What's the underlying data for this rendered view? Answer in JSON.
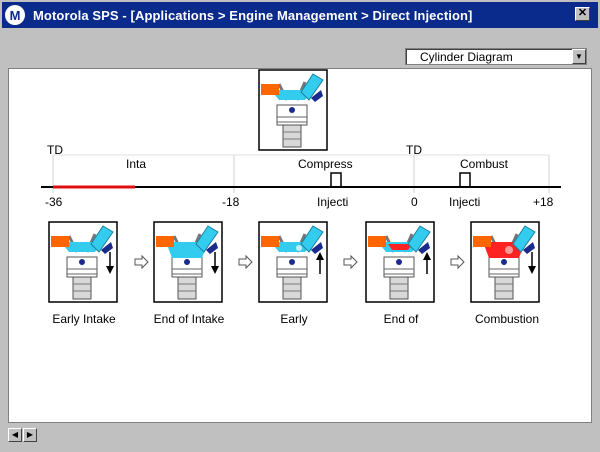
{
  "window": {
    "logo_glyph": "M",
    "title": "Motorola SPS - [Applications > Engine Management > Direct Injection]",
    "close_glyph": "✕"
  },
  "view_select": {
    "value": "Cylinder Diagram",
    "arrow": "▼"
  },
  "timeline": {
    "td_labels": [
      "TD",
      "TD"
    ],
    "phases": [
      "Inta",
      "Compress",
      "Combust"
    ],
    "ticks": [
      "-36",
      "-18",
      "Injecti",
      "0",
      "Injecti",
      "+18"
    ]
  },
  "stages": [
    {
      "caption": "Early Intake",
      "arrow": "down"
    },
    {
      "caption": "End of Intake",
      "arrow": "down"
    },
    {
      "caption": "Early",
      "arrow": "up"
    },
    {
      "caption": "End of",
      "arrow": "up"
    },
    {
      "caption": "Combustion",
      "arrow": "down"
    }
  ],
  "colors": {
    "titlebar": "#0a2a8c",
    "intake": "#ff6600",
    "cylinder": "#33ccee",
    "combustion": "#ff2222",
    "timeline_highlight": "#e01010"
  },
  "scroll": {
    "left_arrow": "◀",
    "right_arrow": "▶"
  }
}
